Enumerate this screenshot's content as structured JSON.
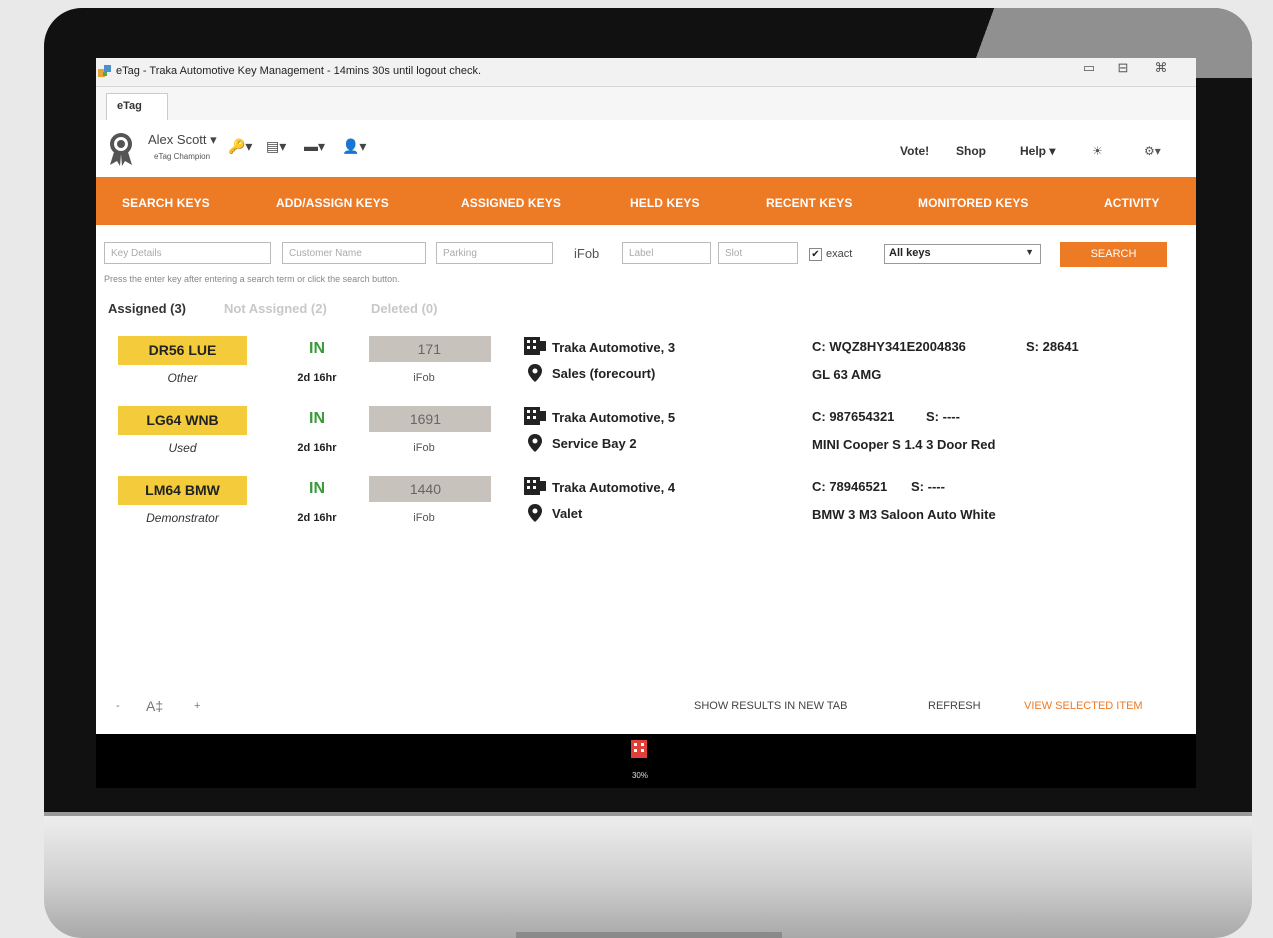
{
  "window": {
    "title": "eTag - Traka Automotive Key Management - 14mins 30s until logout check.",
    "tab_label": "eTag",
    "minimize": "▭",
    "maximize": "⊟",
    "close": "⌘"
  },
  "user": {
    "name": "Alex Scott ▾",
    "role": "eTag Champion"
  },
  "tools": [
    {
      "icon": "key-icon",
      "label": "🔑▾"
    },
    {
      "icon": "building-icon",
      "label": "▤▾"
    },
    {
      "icon": "fob-icon",
      "label": "▬▾"
    },
    {
      "icon": "person-icon",
      "label": "👤▾"
    }
  ],
  "top_links": {
    "vote": "Vote!",
    "shop": "Shop",
    "help": "Help ▾",
    "light": "☀",
    "settings": "⚙▾"
  },
  "nav": [
    "SEARCH KEYS",
    "ADD/ASSIGN KEYS",
    "ASSIGNED KEYS",
    "HELD KEYS",
    "RECENT KEYS",
    "MONITORED KEYS",
    "ACTIVITY"
  ],
  "search": {
    "key_details_placeholder": "Key Details",
    "customer_name_placeholder": "Customer Name",
    "parking_placeholder": "Parking",
    "ifob_label": "iFob",
    "label_placeholder": "Label",
    "slot_placeholder": "Slot",
    "exact_checked": "✔",
    "exact_label": "exact",
    "filter_value": "All keys",
    "button": "SEARCH",
    "hint": "Press the enter key after entering a search term or click the search button."
  },
  "filter_tabs": {
    "assigned": "Assigned (3)",
    "not_assigned": "Not Assigned (2)",
    "deleted": "Deleted (0)"
  },
  "rows": [
    {
      "plate": "DR56 LUE",
      "type": "Other",
      "status": "IN",
      "duration": "2d 16hr",
      "fob": "171",
      "fob_type": "iFob",
      "site": "Traka Automotive, 3",
      "location": "Sales (forecourt)",
      "chassis": "C: WQZ8HY341E2004836",
      "stock": "S: 28641",
      "vehicle": "GL 63 AMG"
    },
    {
      "plate": "LG64 WNB",
      "type": "Used",
      "status": "IN",
      "duration": "2d 16hr",
      "fob": "1691",
      "fob_type": "iFob",
      "site": "Traka Automotive, 5",
      "location": "Service Bay 2",
      "chassis": "C: 987654321",
      "stock": "S: ----",
      "vehicle": "MINI Cooper S 1.4 3 Door Red"
    },
    {
      "plate": "LM64 BMW",
      "type": "Demonstrator",
      "status": "IN",
      "duration": "2d 16hr",
      "fob": "1440",
      "fob_type": "iFob",
      "site": "Traka Automotive, 4",
      "location": "Valet",
      "chassis": "C: 78946521",
      "stock": "S: ----",
      "vehicle": "BMW 3 M3 Saloon Auto White"
    }
  ],
  "footer": {
    "font_minus": "-",
    "font_size": "A‡",
    "font_plus": "+",
    "show_new_tab": "SHOW RESULTS IN NEW TAB",
    "refresh": "REFRESH",
    "view_selected": "VIEW SELECTED ITEM"
  },
  "taskbar": {
    "label": "30%"
  },
  "colors": {
    "accent_orange": "#ed7a24",
    "plate_yellow": "#f4cc3b",
    "status_green": "#3b9a3b"
  }
}
